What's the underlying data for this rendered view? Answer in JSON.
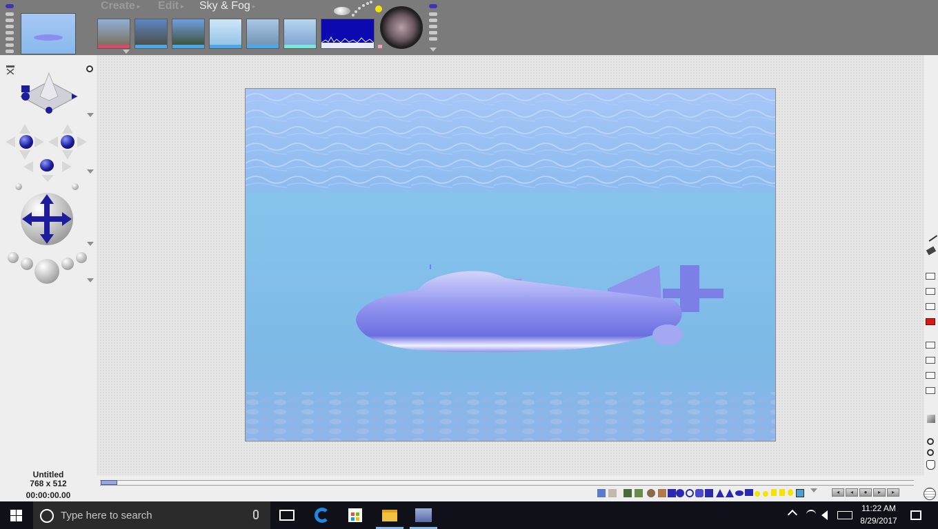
{
  "menu": {
    "create_label": "Create",
    "edit_label": "Edit",
    "sky_label": "Sky & Fog",
    "arrow": "▸"
  },
  "presets": [
    {
      "name": "sky-preset-1",
      "top": "#8fb0d6",
      "bottom": "#7a6a50",
      "strip": "#d84a6a"
    },
    {
      "name": "sky-preset-2",
      "top": "#5d86c4",
      "bottom": "#4a4a3a",
      "strip": "#4aa8e8"
    },
    {
      "name": "sky-preset-3",
      "top": "#6f9fe0",
      "bottom": "#3a4a2a",
      "strip": "#4aa8e8"
    },
    {
      "name": "sky-preset-4",
      "top": "#cfe6f8",
      "bottom": "#8fbfe4",
      "strip": "#4aa8e8"
    },
    {
      "name": "sky-preset-5",
      "top": "#a9c7e6",
      "bottom": "#6f8fb0",
      "strip": "#4aa8e8"
    },
    {
      "name": "sky-preset-6",
      "top": "#b8d4f0",
      "bottom": "#7aa0d0",
      "strip": "#7ae8d8"
    },
    {
      "name": "sky-preset-7",
      "top": "#0a0ab0",
      "bottom": "#2a2ad0",
      "strip": "#f0a0c0"
    }
  ],
  "document": {
    "title": "Untitled",
    "size": "768 x 512",
    "time": "00:00:00.00"
  },
  "taskbar": {
    "search_placeholder": "Type here to search",
    "time": "11:22 AM",
    "date": "8/29/2017"
  },
  "colors": {
    "water_top": "#9fc4f5",
    "water_mid": "#7fb6e8",
    "submarine": "#8a8ef0",
    "accent_blue": "#1c1c9c"
  },
  "icons": {
    "windows": "windows-start-icon",
    "search": "search-icon",
    "mic": "microphone-icon",
    "taskview": "task-view-icon",
    "edge": "edge-browser-icon",
    "store": "store-icon",
    "explorer": "file-explorer-icon",
    "bryce": "bryce-app-icon",
    "notification": "notification-icon"
  }
}
